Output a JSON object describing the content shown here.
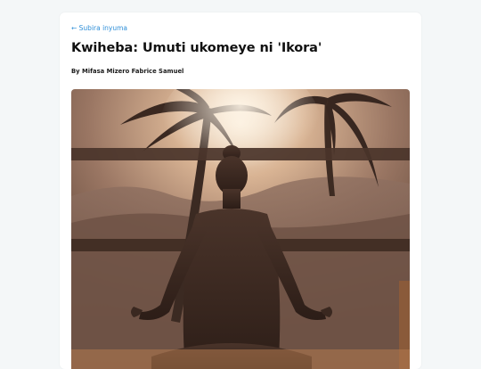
{
  "article": {
    "back_link": "← Subira inyuma",
    "title": "Kwiheba: Umuti ukomeye ni 'Ikora'",
    "byline": "By Mifasa Mizero Fabrice Samuel"
  },
  "hero_image": {
    "icon": "meditation-photo",
    "subject": "silhouette-meditating-under-palm-trees"
  },
  "colors": {
    "page_bg": "#f4f7f8",
    "card_bg": "#ffffff",
    "link": "#2f8fd8",
    "text": "#111111"
  }
}
